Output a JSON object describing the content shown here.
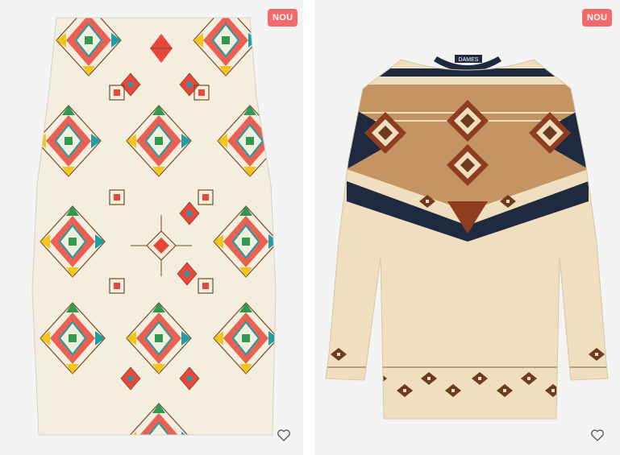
{
  "products": [
    {
      "badge": "NOU",
      "image": "pencil-skirt-geometric-print",
      "wishlist_icon": "heart-outline-icon",
      "colors": {
        "base": "#f3eedd",
        "red": "#e8483b",
        "green": "#2f9a52",
        "yellow": "#f2c619",
        "teal": "#1e9fa6",
        "brown": "#7a4a2a"
      }
    },
    {
      "badge": "NOU",
      "image": "long-sleeve-blouse-aztec-print",
      "wishlist_icon": "heart-outline-icon",
      "label_text": "DAMES",
      "colors": {
        "base": "#efdfbf",
        "navy": "#1f2a40",
        "rust": "#8f3d1f",
        "brown": "#6e3b1e",
        "tan": "#c59463"
      }
    }
  ],
  "theme": {
    "badge_bg": "#f46a6a",
    "badge_text": "#ffffff",
    "card_bg": "#f4f4f4"
  }
}
